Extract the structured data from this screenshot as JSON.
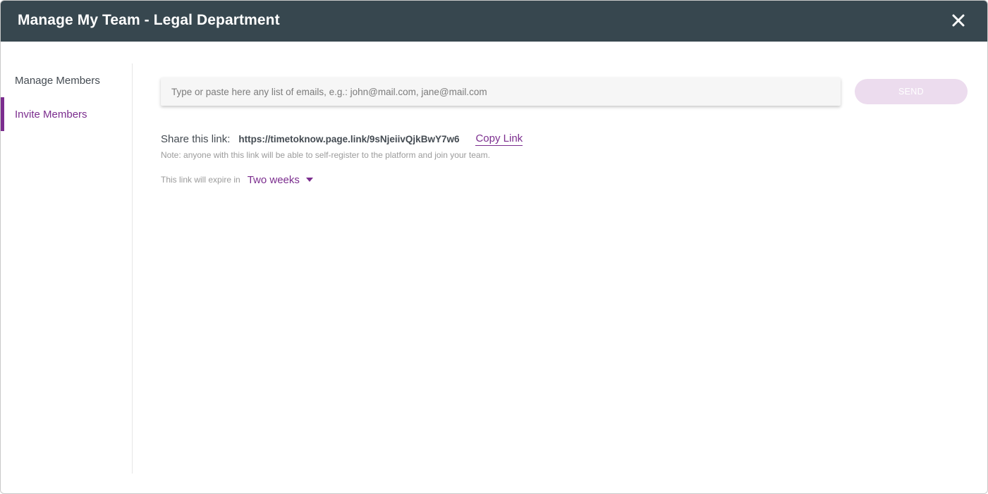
{
  "header": {
    "title": "Manage My Team - Legal Department",
    "close_icon": "close-icon"
  },
  "sidebar": {
    "items": [
      {
        "label": "Manage Members",
        "active": false
      },
      {
        "label": "Invite Members",
        "active": true
      }
    ]
  },
  "invite": {
    "email_input": {
      "value": "",
      "placeholder": "Type or paste here any list of emails, e.g.: john@mail.com, jane@mail.com"
    },
    "send_label": "SEND",
    "share_label": "Share this link:",
    "share_url": "https://timetoknow.page.link/9sNjeiivQjkBwY7w6",
    "copy_label": "Copy Link",
    "note": "Note: anyone with this link will be able to self-register to the platform and join your team.",
    "expire_label": "This link will expire in",
    "expire_value": "Two weeks",
    "expire_icon": "caret-down-icon"
  },
  "colors": {
    "header_bg": "#37474f",
    "accent": "#7b2d8e",
    "send_disabled_bg": "#ecdcee"
  }
}
